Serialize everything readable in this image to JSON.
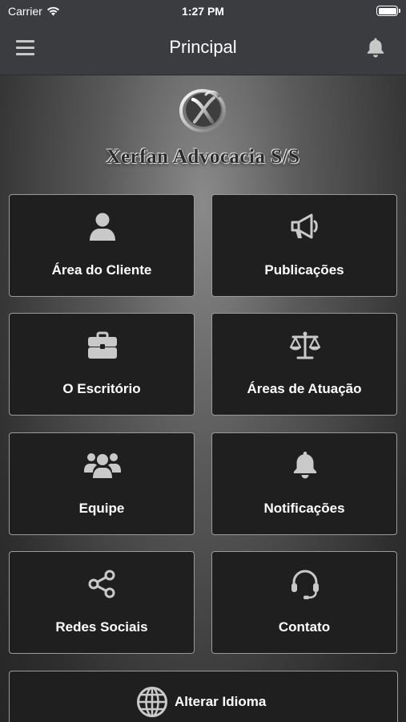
{
  "status_bar": {
    "carrier": "Carrier",
    "time": "1:27 PM"
  },
  "nav": {
    "title": "Principal",
    "menu_icon": "hamburger-menu-icon",
    "bell_icon": "bell-icon"
  },
  "logo": {
    "firm_name": "Xerfan Advocacia S/S",
    "emblem_icon": "x-monogram-emblem"
  },
  "tiles": [
    {
      "label": "Área do Cliente",
      "icon": "user-icon"
    },
    {
      "label": "Publicações",
      "icon": "megaphone-icon"
    },
    {
      "label": "O Escritório",
      "icon": "briefcase-icon"
    },
    {
      "label": "Áreas de Atuação",
      "icon": "scales-icon"
    },
    {
      "label": "Equipe",
      "icon": "team-icon"
    },
    {
      "label": "Notificações",
      "icon": "bell-icon"
    },
    {
      "label": "Redes Sociais",
      "icon": "share-icon"
    },
    {
      "label": "Contato",
      "icon": "headset-icon"
    }
  ],
  "language_button": {
    "label": "Alterar Idioma",
    "icon": "globe-icon"
  },
  "colors": {
    "tile_bg": "#1f1f20",
    "tile_border": "#9a9a9a",
    "icon": "#c9c9c9",
    "nav_bg": "#3a3c3f"
  }
}
